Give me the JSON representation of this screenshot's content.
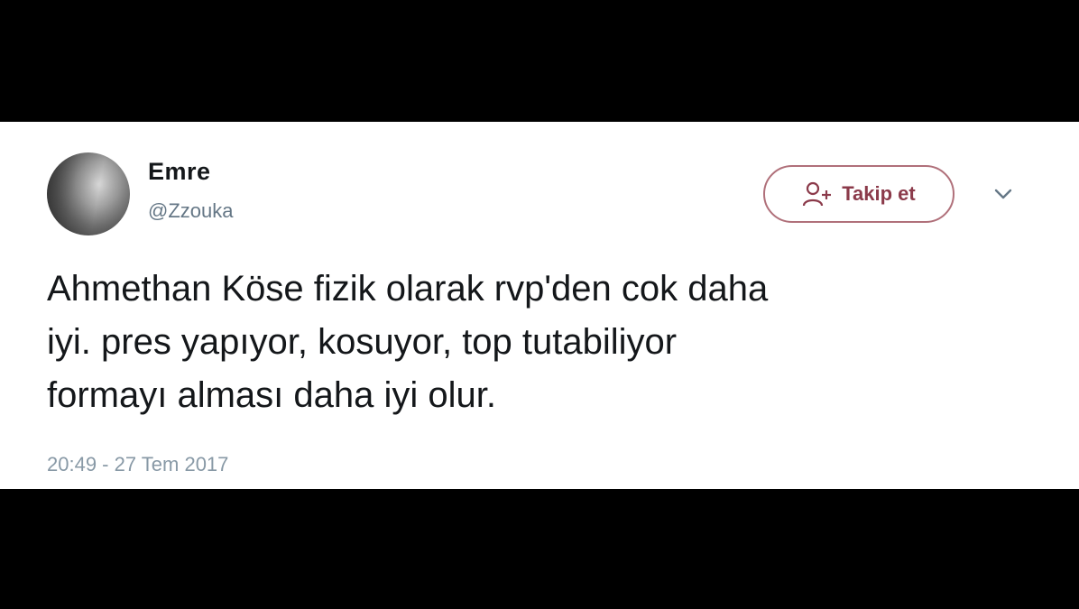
{
  "user": {
    "name": "Emre",
    "handle": "@Zzouka"
  },
  "follow_button": {
    "label": "Takip et",
    "icon": "add-user-icon"
  },
  "menu": {
    "icon": "chevron-down-icon"
  },
  "tweet": {
    "text": "Ahmethan Köse fizik olarak rvp'den cok daha\niyi. pres yapıyor, kosuyor, top tutabiliyor\nformayı alması daha iyi olur.",
    "timestamp": "20:49 - 27 Tem 2017"
  },
  "colors": {
    "background": "#000000",
    "card": "#ffffff",
    "accent": "#8b3a4a",
    "muted": "#657786"
  }
}
